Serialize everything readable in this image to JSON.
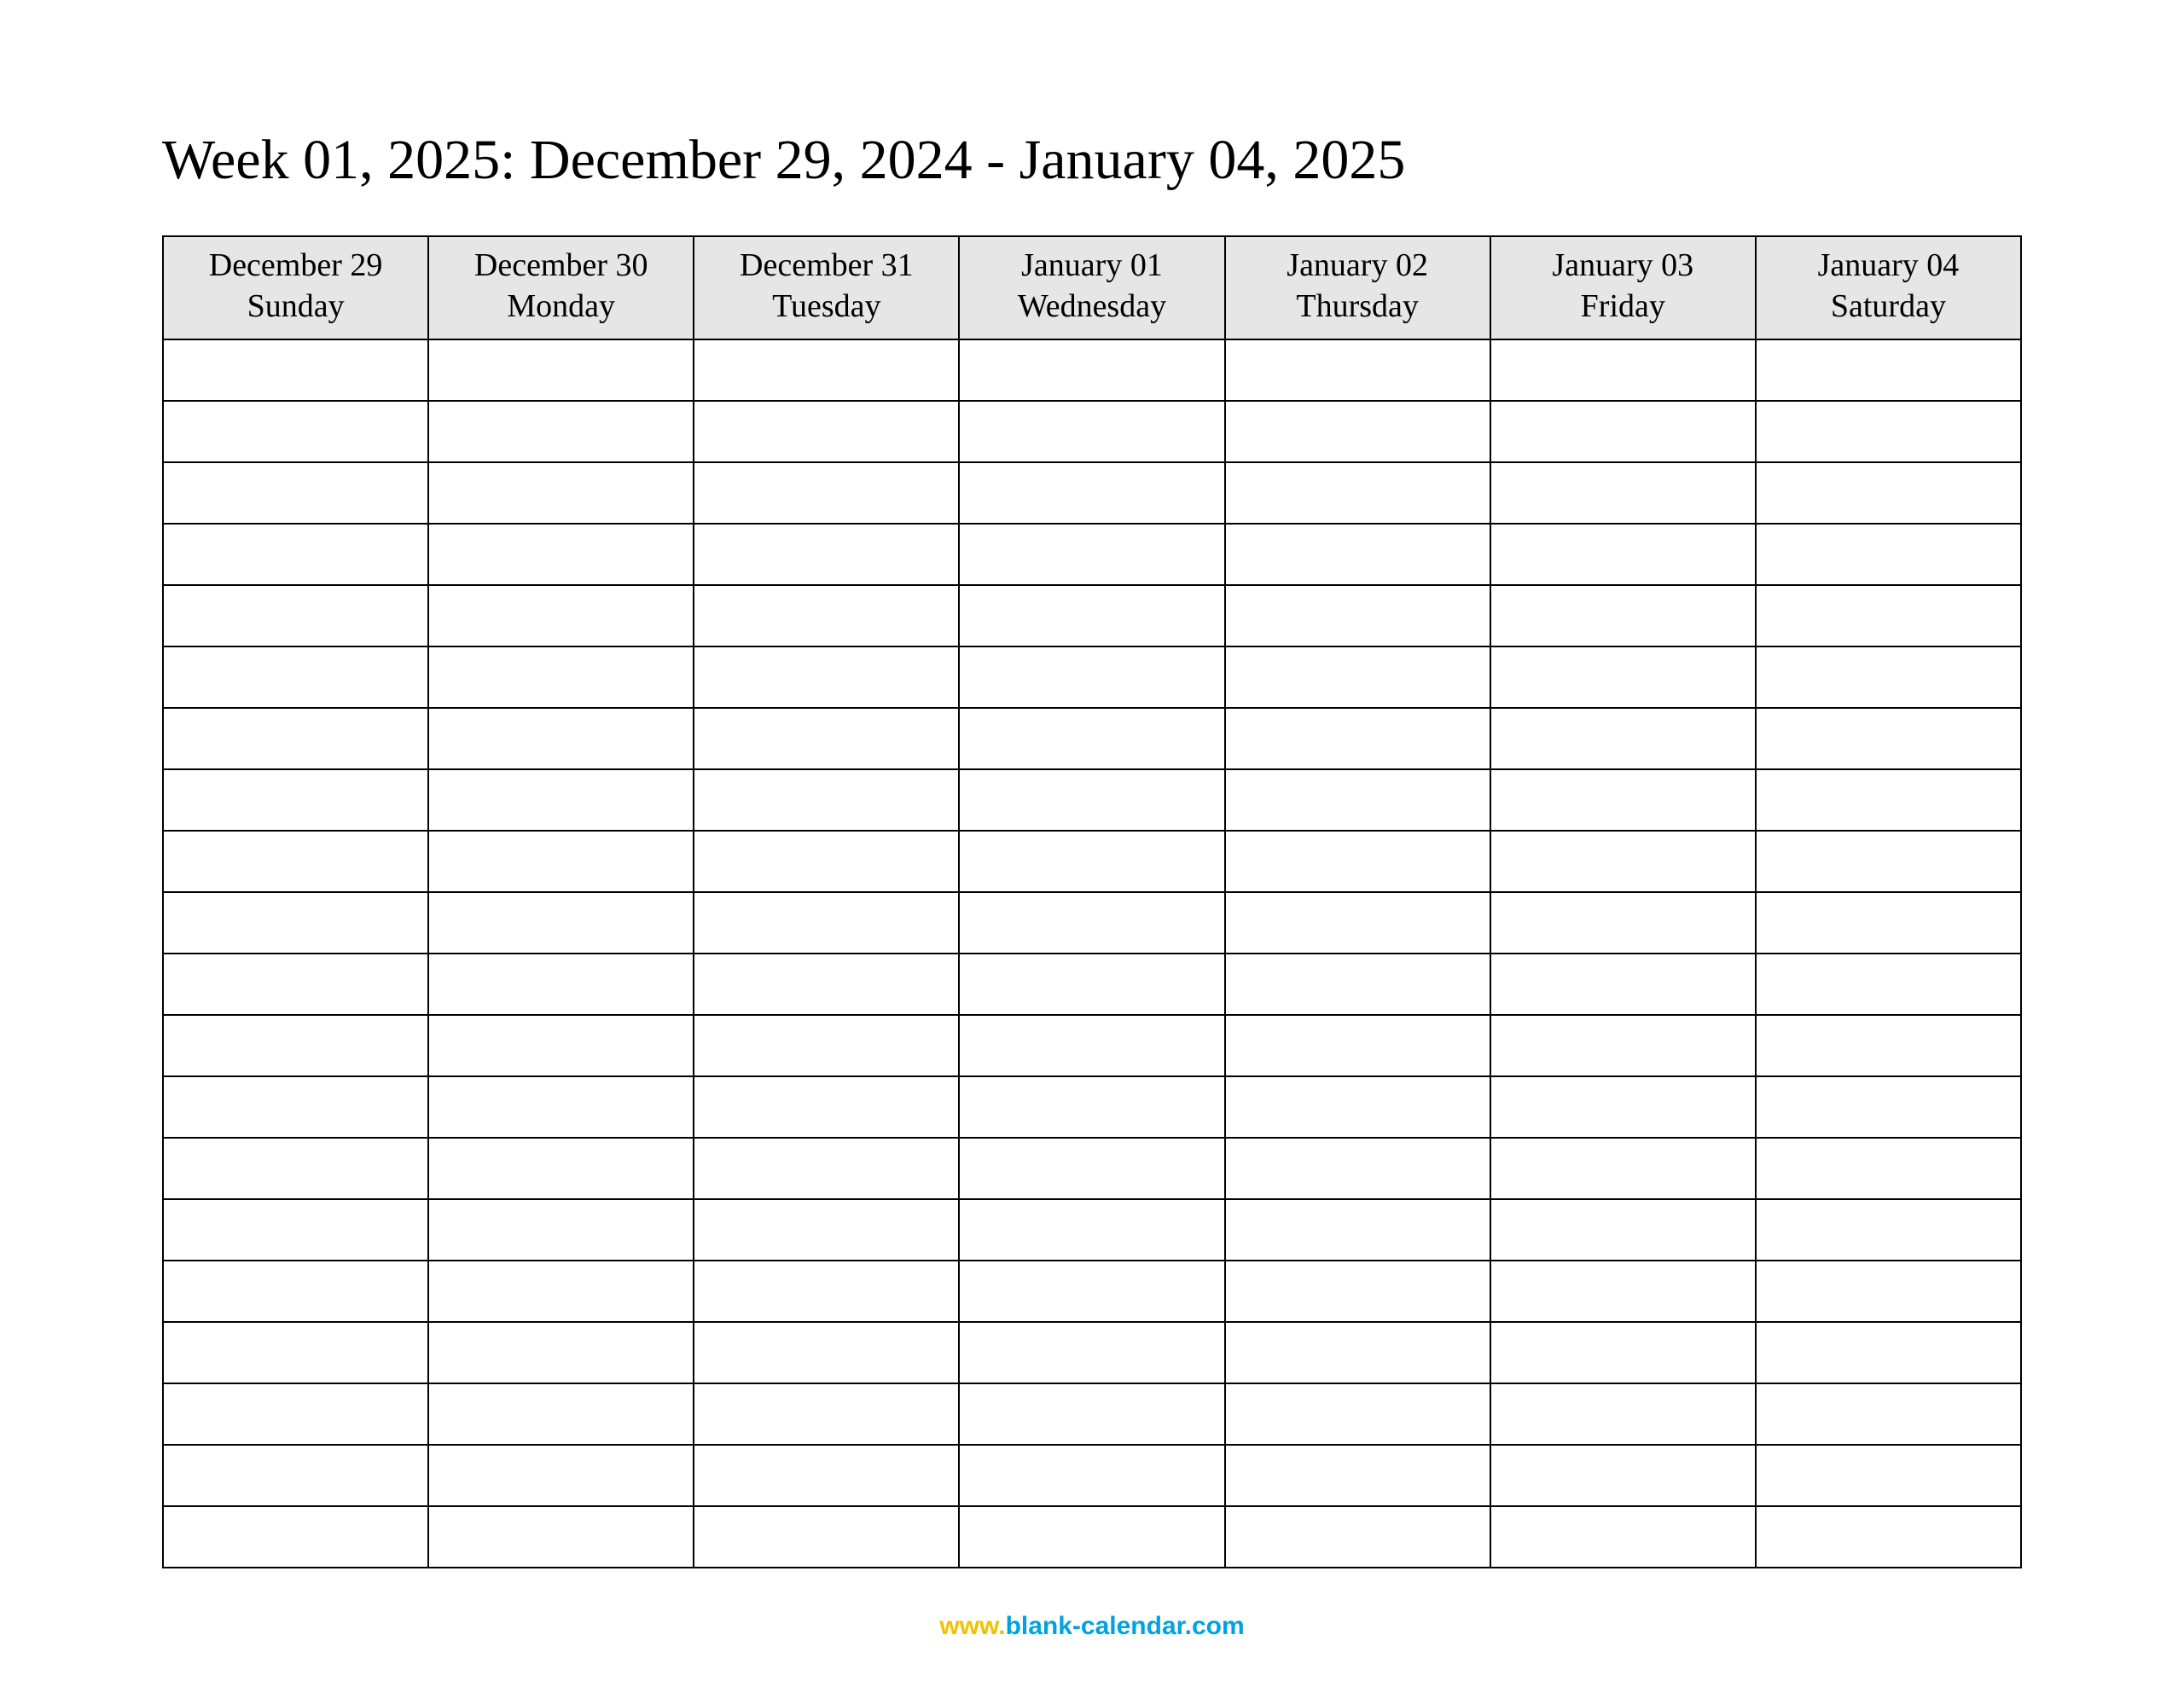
{
  "title": "Week 01, 2025: December 29, 2024 - January 04, 2025",
  "columns": [
    {
      "date": "December 29",
      "day": "Sunday"
    },
    {
      "date": "December 30",
      "day": "Monday"
    },
    {
      "date": "December 31",
      "day": "Tuesday"
    },
    {
      "date": "January 01",
      "day": "Wednesday"
    },
    {
      "date": "January 02",
      "day": "Thursday"
    },
    {
      "date": "January 03",
      "day": "Friday"
    },
    {
      "date": "January 04",
      "day": "Saturday"
    }
  ],
  "row_count": 20,
  "footer": {
    "www": "www.",
    "domain": "blank-calendar.com"
  }
}
